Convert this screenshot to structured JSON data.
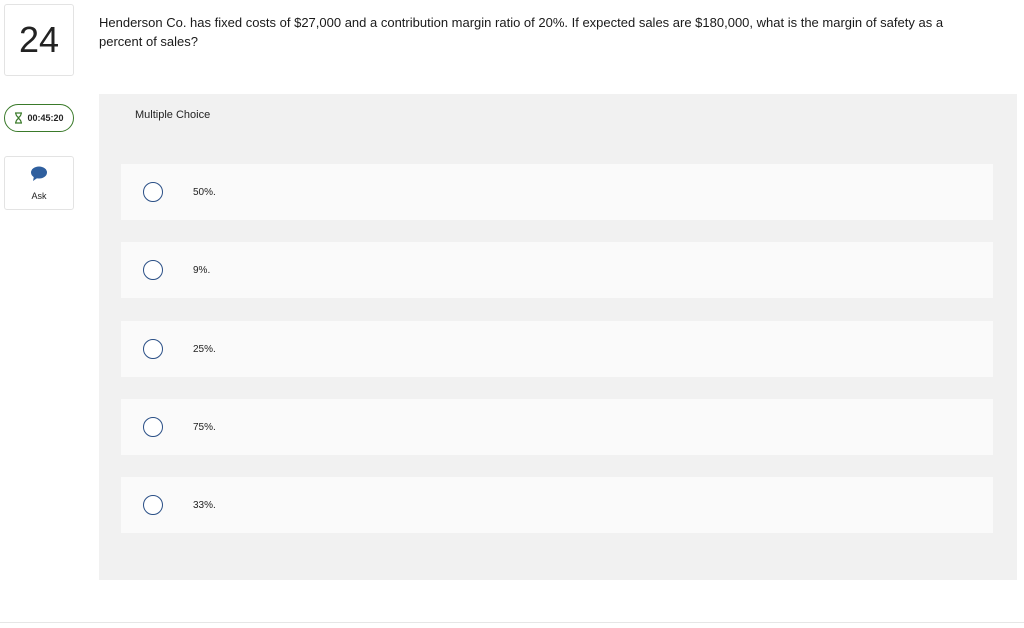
{
  "question_number": "24",
  "timer": {
    "value": "00:45:20",
    "icon": "hourglass-icon",
    "border_color": "#3a7a2a"
  },
  "ask": {
    "label": "Ask",
    "icon": "speech-bubble-icon",
    "icon_color": "#2f5f9e"
  },
  "question_text": "Henderson Co. has fixed costs of $27,000 and a contribution margin ratio of 20%. If expected sales are $180,000, what is the margin of safety as a percent of sales?",
  "answer_panel": {
    "title": "Multiple Choice",
    "choices": [
      {
        "label": "50%."
      },
      {
        "label": "9%."
      },
      {
        "label": "25%."
      },
      {
        "label": "75%."
      },
      {
        "label": "33%."
      }
    ]
  }
}
